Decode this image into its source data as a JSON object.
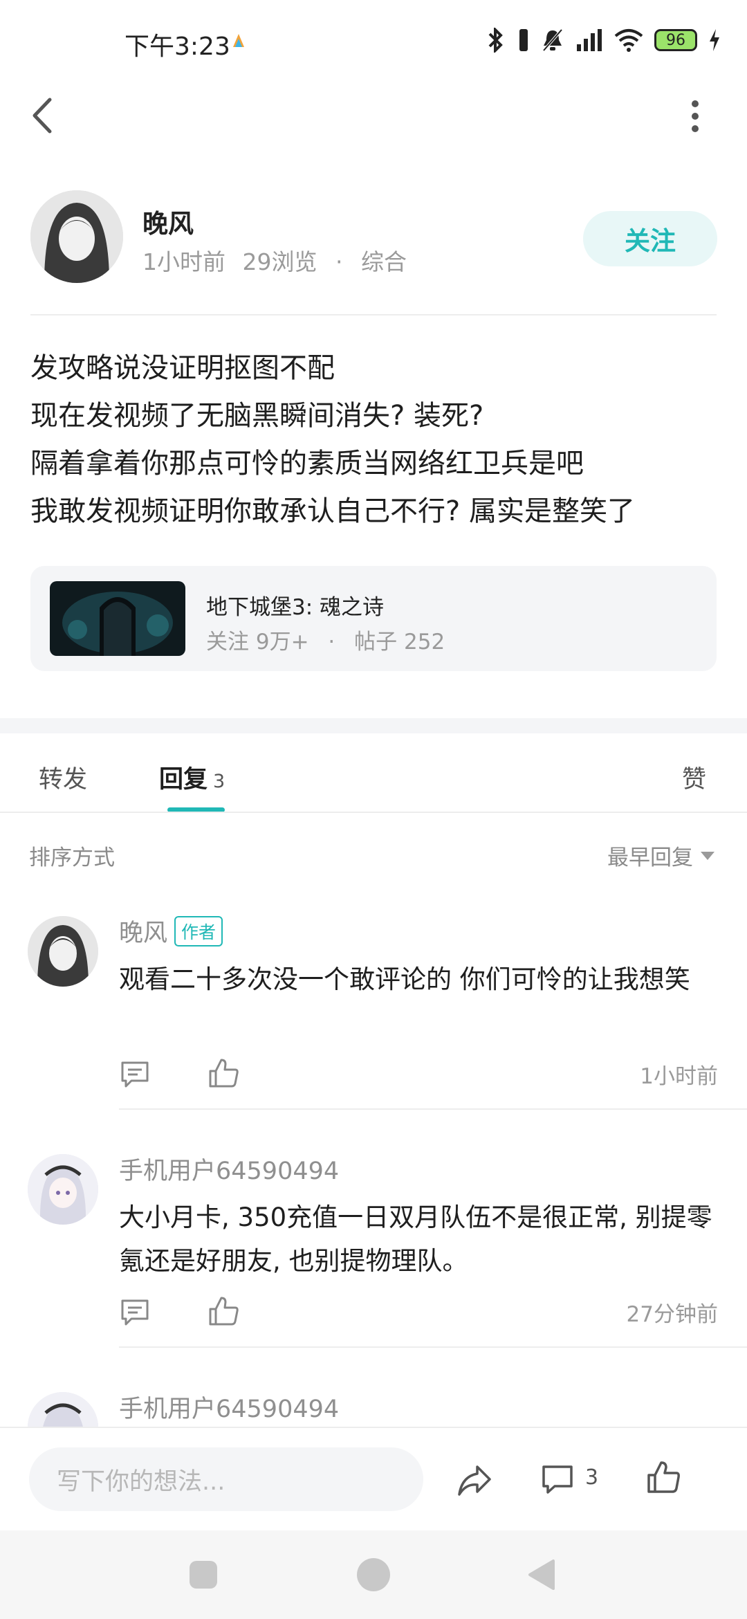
{
  "status_bar": {
    "time": "下午3:23",
    "battery": "96"
  },
  "author": {
    "name": "晚风",
    "time_ago": "1小时前",
    "views": "29浏览",
    "category": "综合",
    "follow_label": "关注"
  },
  "post": {
    "lines": [
      "发攻略说没证明抠图不配",
      "现在发视频了无脑黑瞬间消失? 装死?",
      "隔着拿着你那点可怜的素质当网络红卫兵是吧",
      "我敢发视频证明你敢承认自己不行? 属实是整笑了"
    ]
  },
  "game_card": {
    "title": "地下城堡3: 魂之诗",
    "followers": "关注 9万+",
    "posts": "帖子 252"
  },
  "tabs": {
    "repost": "转发",
    "reply": "回复",
    "reply_count": "3",
    "like": "赞"
  },
  "sort": {
    "label": "排序方式",
    "value": "最早回复"
  },
  "comments": [
    {
      "name": "晚风",
      "tag": "作者",
      "text": "观看二十多次没一个敢评论的  你们可怜的让我想笑",
      "time": "1小时前"
    },
    {
      "name": "手机用户64590494",
      "text": "大小月卡, 350充值一日双月队伍不是很正常, 别提零氪还是好朋友, 也别提物理队。",
      "time": "27分钟前"
    },
    {
      "name": "手机用户64590494"
    }
  ],
  "bottom_bar": {
    "input_placeholder": "写下你的想法...",
    "comment_count": "3"
  },
  "colors": {
    "accent": "#20b8b6",
    "follow_bg": "#e8f7f7"
  }
}
